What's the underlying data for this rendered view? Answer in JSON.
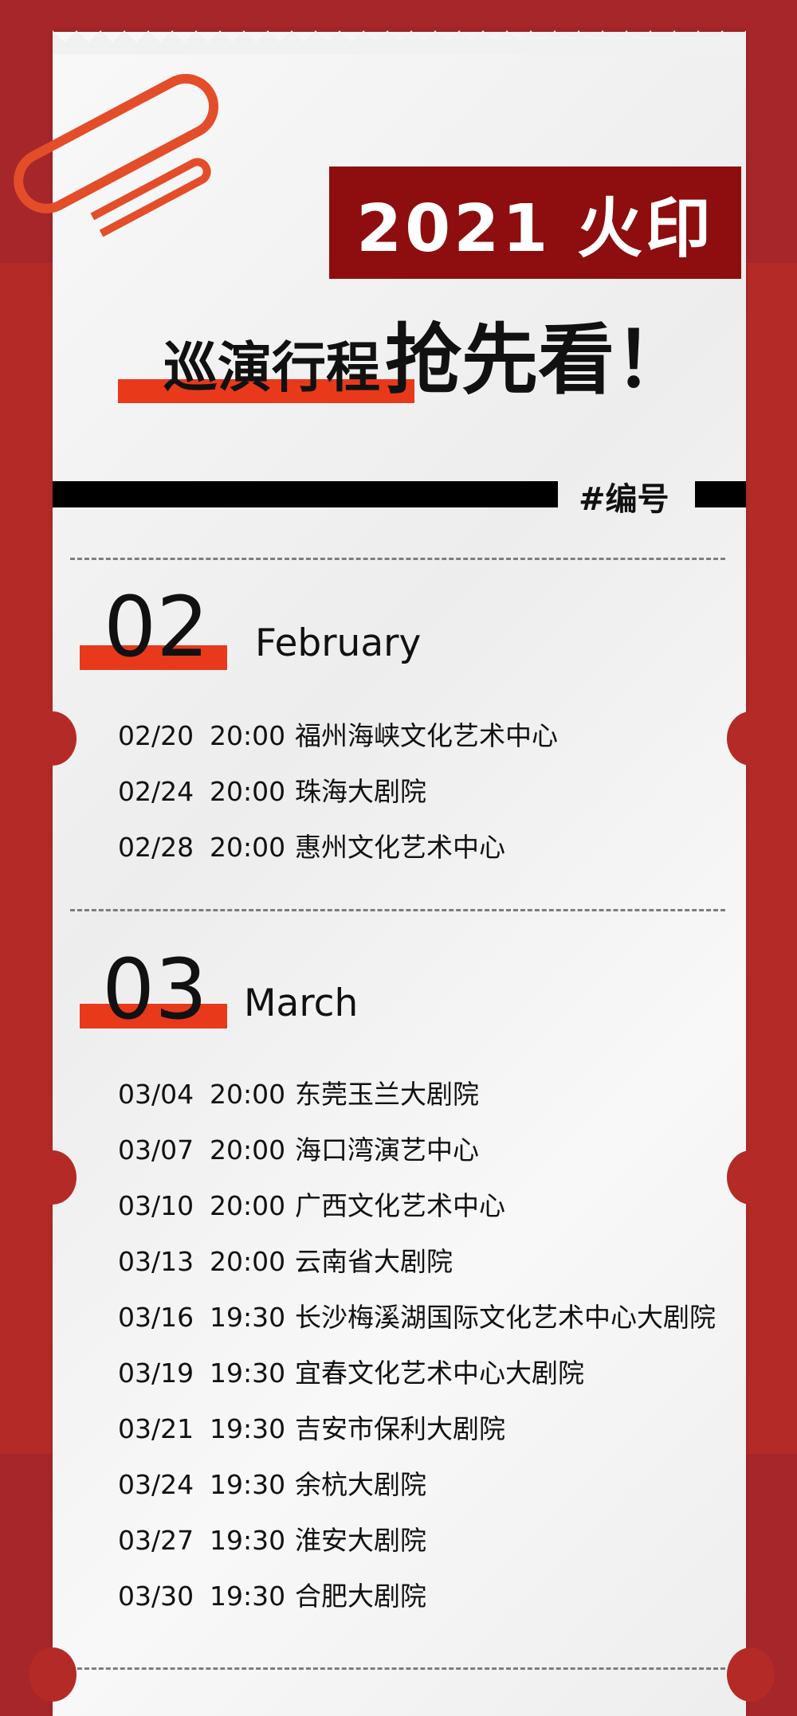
{
  "header": {
    "badge": "2021 火印",
    "headline_part1": "巡演行程",
    "headline_part2": "抢先看！",
    "tag": "#编号"
  },
  "months": [
    {
      "number": "02",
      "name": "February",
      "shows": [
        {
          "date": "02/20",
          "time": "20:00",
          "venue": "福州海峡文化艺术中心"
        },
        {
          "date": "02/24",
          "time": "20:00",
          "venue": "珠海大剧院"
        },
        {
          "date": "02/28",
          "time": "20:00",
          "venue": "惠州文化艺术中心"
        }
      ]
    },
    {
      "number": "03",
      "name": "March",
      "shows": [
        {
          "date": "03/04",
          "time": "20:00",
          "venue": "东莞玉兰大剧院"
        },
        {
          "date": "03/07",
          "time": "20:00",
          "venue": "海口湾演艺中心"
        },
        {
          "date": "03/10",
          "time": "20:00",
          "venue": "广西文化艺术中心"
        },
        {
          "date": "03/13",
          "time": "20:00",
          "venue": "云南省大剧院"
        },
        {
          "date": "03/16",
          "time": "19:30",
          "venue": "长沙梅溪湖国际文化艺术中心大剧院"
        },
        {
          "date": "03/19",
          "time": "19:30",
          "venue": "宜春文化艺术中心大剧院"
        },
        {
          "date": "03/21",
          "time": "19:30",
          "venue": "吉安市保利大剧院"
        },
        {
          "date": "03/24",
          "time": "19:30",
          "venue": "余杭大剧院"
        },
        {
          "date": "03/27",
          "time": "19:30",
          "venue": "淮安大剧院"
        },
        {
          "date": "03/30",
          "time": "19:30",
          "venue": "合肥大剧院"
        }
      ]
    }
  ],
  "colors": {
    "background": "#b42a27",
    "badge": "#8e0d0f",
    "accent": "#e8391b",
    "paper": "#f1f1f1"
  }
}
